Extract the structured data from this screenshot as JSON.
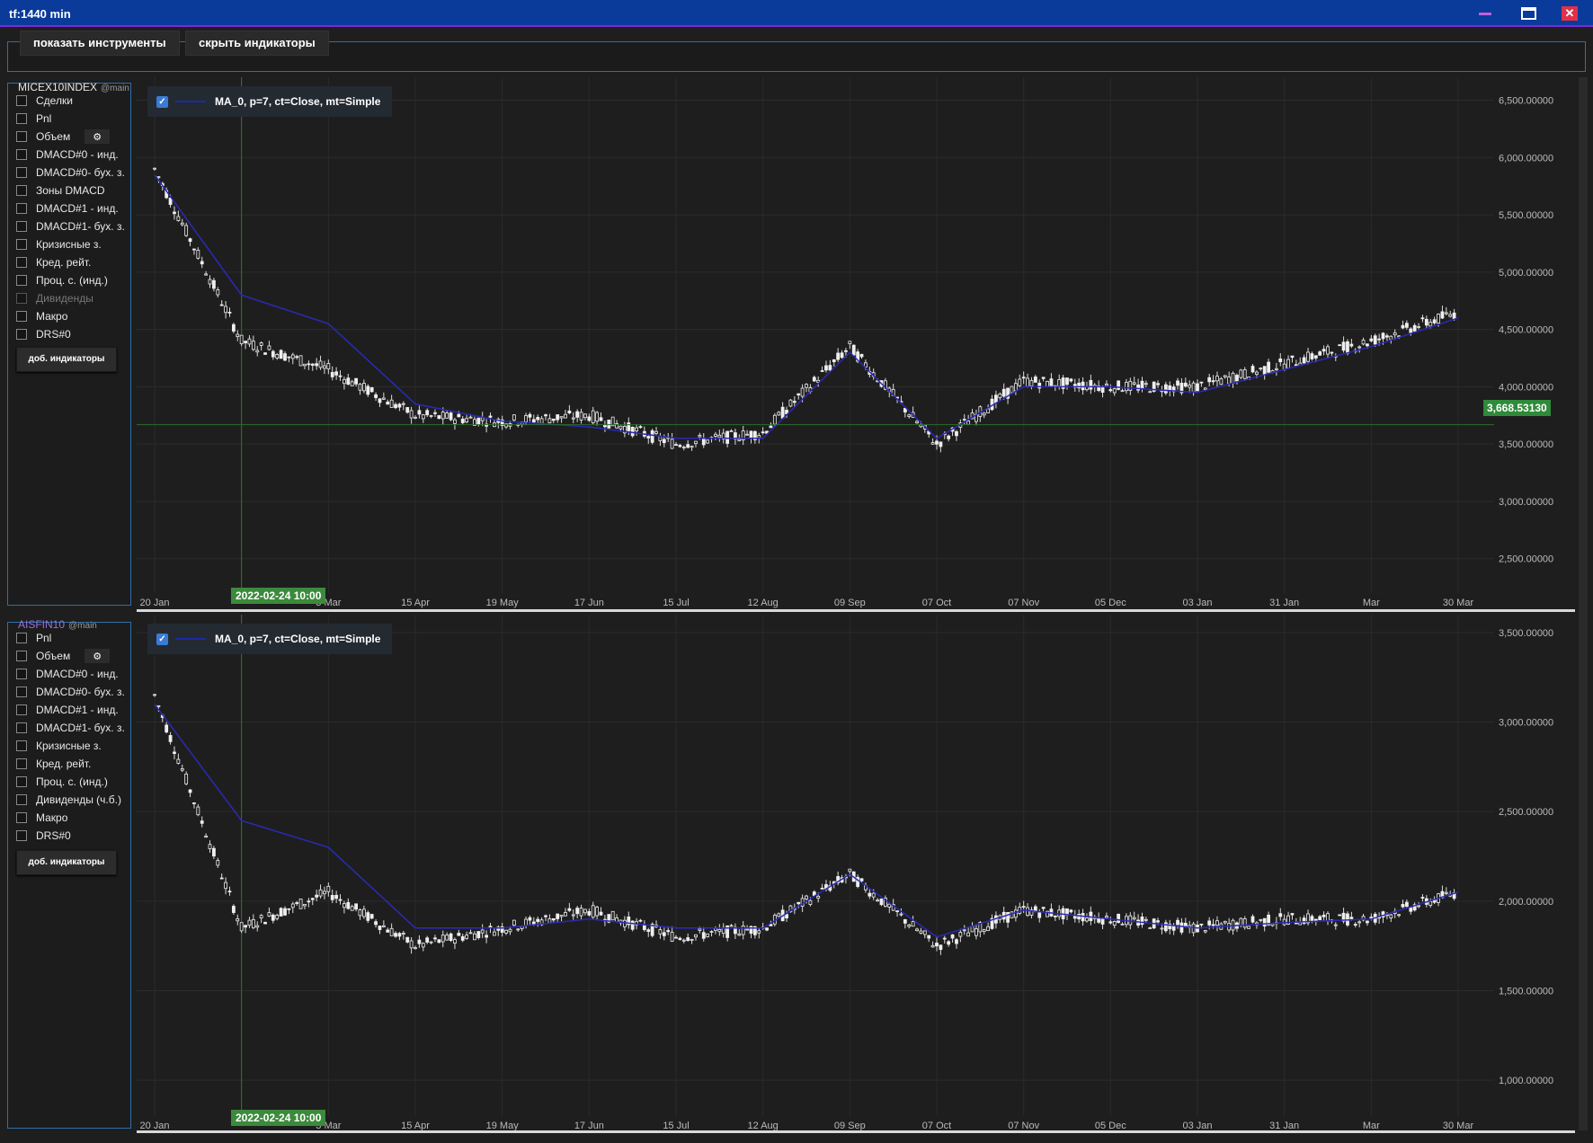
{
  "window": {
    "title": "tf:1440 min",
    "minimize_icon": "minimize-icon",
    "maximize_icon": "maximize-icon",
    "close_icon": "close-icon",
    "close_color": "#e0304a",
    "minimize_color": "#c060e0"
  },
  "toolbar": {
    "show_instruments": "показать инструменты",
    "hide_indicators": "скрыть индикаторы"
  },
  "panes": [
    {
      "instrument": "MICEX10INDEX",
      "tag": "@main",
      "instrument_color": "#e6e6e6",
      "indicators": [
        {
          "label": "Сделки",
          "enabled": true
        },
        {
          "label": "Pnl",
          "enabled": true
        },
        {
          "label": "Объем",
          "enabled": true,
          "gear": true
        },
        {
          "label": "DMACD#0 - инд.",
          "enabled": true
        },
        {
          "label": "DMACD#0- бух. з.",
          "enabled": true
        },
        {
          "label": "Зоны DMACD",
          "enabled": true
        },
        {
          "label": "DMACD#1 - инд.",
          "enabled": true
        },
        {
          "label": "DMACD#1- бух. з.",
          "enabled": true
        },
        {
          "label": "Кризисные з.",
          "enabled": true
        },
        {
          "label": "Кред. рейт.",
          "enabled": true
        },
        {
          "label": "Проц. с. (инд.)",
          "enabled": true
        },
        {
          "label": "Дивиденды",
          "enabled": false
        },
        {
          "label": "Макро",
          "enabled": true
        },
        {
          "label": "DRS#0",
          "enabled": true
        }
      ],
      "add_indicators": "доб. индикаторы",
      "legend": "MA_0, p=7, ct=Close, mt=Simple",
      "crosshair_date": "2022-02-24 10:00",
      "crosshair_price": "3,668.53130",
      "y_ticks": [
        "6,500.00000",
        "6,000.00000",
        "5,500.00000",
        "5,000.00000",
        "4,500.00000",
        "4,000.00000",
        "3,500.00000",
        "3,000.00000",
        "2,500.00000"
      ],
      "x_ticks": [
        "20 Jan",
        "3 Mar",
        "15 Apr",
        "19 May",
        "17 Jun",
        "15 Jul",
        "12 Aug",
        "09 Sep",
        "07 Oct",
        "07 Nov",
        "05 Dec",
        "03 Jan",
        "31 Jan",
        "Mar",
        "30 Mar"
      ]
    },
    {
      "instrument": "AISFIN10",
      "tag": "@main",
      "instrument_color": "#9b6fe0",
      "indicators": [
        {
          "label": "Pnl",
          "enabled": true
        },
        {
          "label": "Объем",
          "enabled": true,
          "gear": true
        },
        {
          "label": "DMACD#0 - инд.",
          "enabled": true
        },
        {
          "label": "DMACD#0- бух. з.",
          "enabled": true
        },
        {
          "label": "DMACD#1 - инд.",
          "enabled": true
        },
        {
          "label": "DMACD#1- бух. з.",
          "enabled": true
        },
        {
          "label": "Кризисные з.",
          "enabled": true
        },
        {
          "label": "Кред. рейт.",
          "enabled": true
        },
        {
          "label": "Проц. с. (инд.)",
          "enabled": true
        },
        {
          "label": "Дивиденды (ч.б.)",
          "enabled": true
        },
        {
          "label": "Макро",
          "enabled": true
        },
        {
          "label": "DRS#0",
          "enabled": true
        }
      ],
      "add_indicators": "доб. индикаторы",
      "legend": "MA_0, p=7, ct=Close, mt=Simple",
      "crosshair_date": "2022-02-24 10:00",
      "y_ticks": [
        "3,500.00000",
        "3,000.00000",
        "2,500.00000",
        "2,000.00000",
        "1,500.00000",
        "1,000.00000"
      ],
      "x_ticks": [
        "20 Jan",
        "3 Mar",
        "15 Apr",
        "19 May",
        "17 Jun",
        "15 Jul",
        "12 Aug",
        "09 Sep",
        "07 Oct",
        "07 Nov",
        "05 Dec",
        "03 Jan",
        "31 Jan",
        "Mar",
        "30 Mar"
      ]
    }
  ],
  "chart_data": [
    {
      "type": "line",
      "title": "MICEX10INDEX",
      "xlabel": "",
      "ylabel": "",
      "ylim": [
        2200,
        6700
      ],
      "grid": true,
      "x": [
        "20 Jan",
        "24 Feb",
        "3 Mar",
        "15 Apr",
        "19 May",
        "17 Jun",
        "15 Jul",
        "12 Aug",
        "09 Sep",
        "07 Oct",
        "07 Nov",
        "05 Dec",
        "03 Jan",
        "31 Jan",
        "Mar",
        "30 Mar"
      ],
      "series": [
        {
          "values": [
            5900,
            4400,
            4150,
            3750,
            3700,
            3750,
            3500,
            3600,
            4350,
            3500,
            4050,
            4000,
            4000,
            4200,
            4400,
            4650
          ]
        },
        {
          "name": "MA_0, p=7, ct=Close, mt=Simple",
          "values": [
            5850,
            4800,
            4550,
            3850,
            3700,
            3650,
            3550,
            3550,
            4300,
            3550,
            4000,
            4000,
            3950,
            4150,
            4350,
            4600
          ]
        }
      ]
    },
    {
      "type": "line",
      "title": "AISFIN10",
      "xlabel": "",
      "ylabel": "",
      "ylim": [
        800,
        3600
      ],
      "grid": true,
      "x": [
        "20 Jan",
        "24 Feb",
        "3 Mar",
        "15 Apr",
        "19 May",
        "17 Jun",
        "15 Jul",
        "12 Aug",
        "09 Sep",
        "07 Oct",
        "07 Nov",
        "05 Dec",
        "03 Jan",
        "31 Jan",
        "Mar",
        "30 Mar"
      ],
      "series": [
        {
          "values": [
            3150,
            1850,
            2050,
            1750,
            1850,
            1950,
            1800,
            1850,
            2150,
            1750,
            1950,
            1900,
            1850,
            1900,
            1900,
            2050
          ]
        },
        {
          "name": "MA_0, p=7, ct=Close, mt=Simple",
          "values": [
            3100,
            2450,
            2300,
            1850,
            1850,
            1900,
            1850,
            1850,
            2150,
            1800,
            1950,
            1900,
            1850,
            1880,
            1900,
            2050
          ]
        }
      ]
    }
  ]
}
